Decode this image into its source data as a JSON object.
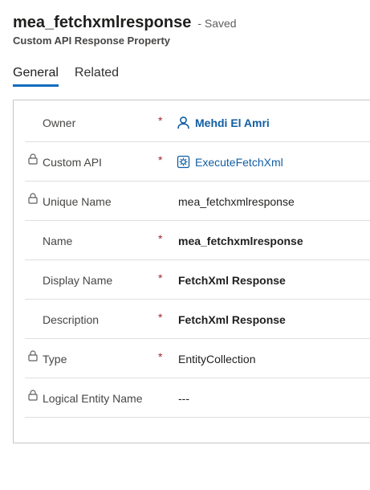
{
  "header": {
    "title": "mea_fetchxmlresponse",
    "save_status": "- Saved",
    "entity_name": "Custom API Response Property"
  },
  "tabs": [
    {
      "label": "General",
      "active": true
    },
    {
      "label": "Related",
      "active": false
    }
  ],
  "required_mark": "*",
  "fields": {
    "owner": {
      "label": "Owner",
      "value": "Mehdi El Amri",
      "icon": "person-icon",
      "required": true,
      "locked": false
    },
    "custom_api": {
      "label": "Custom API",
      "value": "ExecuteFetchXml",
      "icon": "custom-api-icon",
      "required": true,
      "locked": true
    },
    "unique_name": {
      "label": "Unique Name",
      "value": "mea_fetchxmlresponse",
      "required": false,
      "locked": true
    },
    "name": {
      "label": "Name",
      "value": "mea_fetchxmlresponse",
      "required": true,
      "locked": false
    },
    "display_name": {
      "label": "Display Name",
      "value": "FetchXml Response",
      "required": true,
      "locked": false
    },
    "description": {
      "label": "Description",
      "value": "FetchXml Response",
      "required": true,
      "locked": false
    },
    "type": {
      "label": "Type",
      "value": "EntityCollection",
      "required": true,
      "locked": true
    },
    "logical_entity_name": {
      "label": "Logical Entity Name",
      "value": "---",
      "required": false,
      "locked": true
    }
  },
  "colors": {
    "accent": "#0f6cbd",
    "link": "#115ea3",
    "required": "#a4262c"
  }
}
